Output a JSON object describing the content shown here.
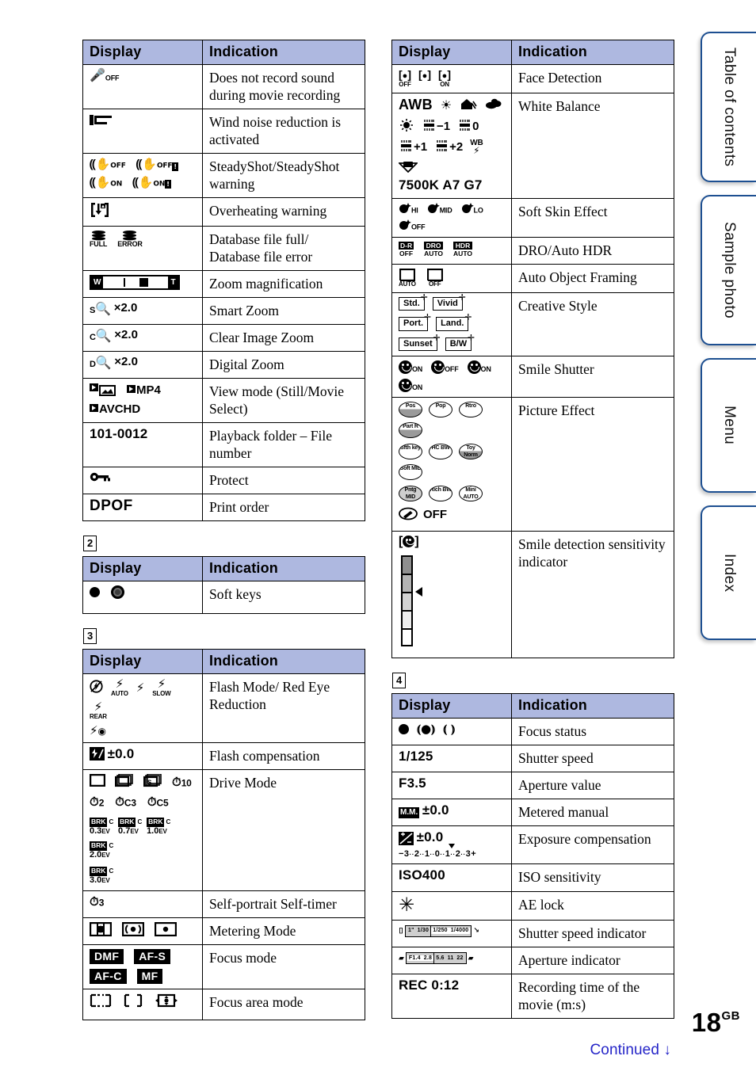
{
  "page": {
    "number": "18",
    "number_suffix": "GB",
    "continued_label": "Continued",
    "continued_arrow": "↓",
    "header_display": "Display",
    "header_indication": "Indication"
  },
  "sidebar": {
    "tabs": [
      {
        "label": "Table of contents",
        "name": "tab-table-of-contents"
      },
      {
        "label": "Sample photo",
        "name": "tab-sample-photo"
      },
      {
        "label": "Menu",
        "name": "tab-menu"
      },
      {
        "label": "Index",
        "name": "tab-index"
      }
    ]
  },
  "sections": [
    {
      "id": "1",
      "number_label": "",
      "column": "left",
      "rows": [
        {
          "indication": "Does not record sound during movie recording",
          "icons": [
            "mic-off-icon"
          ]
        },
        {
          "indication": "Wind noise reduction is activated",
          "icons": [
            "wind-noise-icon"
          ]
        },
        {
          "indication": "SteadyShot/SteadyShot warning",
          "icons": [
            "steadyshot-off",
            "steadyshot-off-warning",
            "steadyshot-on",
            "steadyshot-on-warning"
          ]
        },
        {
          "indication": "Overheating warning",
          "icons": [
            "overheating-icon"
          ]
        },
        {
          "indication": "Database file full/ Database file error",
          "icons": [
            "database-full-icon",
            "database-error-icon"
          ]
        },
        {
          "indication": "Zoom magnification",
          "icons": [
            "zoom-bar-icon"
          ]
        },
        {
          "indication": "Smart Zoom",
          "icons": [
            "smart-zoom-icon"
          ],
          "value": "×2.0",
          "prefix": "S"
        },
        {
          "indication": "Clear Image Zoom",
          "icons": [
            "clear-image-zoom-icon"
          ],
          "value": "×2.0",
          "prefix": "C"
        },
        {
          "indication": "Digital Zoom",
          "icons": [
            "digital-zoom-icon"
          ],
          "value": "×2.0",
          "prefix": "D"
        },
        {
          "indication": "View mode (Still/Movie Select)",
          "icons": [
            "view-still-icon",
            "view-mp4-icon",
            "view-avchd-icon"
          ],
          "labels": [
            "MP4",
            "AVCHD"
          ]
        },
        {
          "indication": "Playback folder – File number",
          "value": "101-0012"
        },
        {
          "indication": "Protect",
          "icons": [
            "protect-key-icon"
          ]
        },
        {
          "indication": "Print order",
          "value": "DPOF"
        }
      ]
    },
    {
      "id": "2",
      "number_label": "2",
      "column": "left",
      "rows": [
        {
          "indication": "Soft keys",
          "icons": [
            "soft-key-dot-icon",
            "soft-key-dial-icon"
          ]
        }
      ]
    },
    {
      "id": "3",
      "number_label": "3",
      "column": "left",
      "rows": [
        {
          "indication": "Flash Mode/ Red Eye Reduction",
          "icons": [
            "flash-off-icon",
            "flash-auto-icon",
            "flash-on-icon",
            "flash-slow-icon",
            "flash-rear-icon",
            "red-eye-icon"
          ],
          "labels": [
            "AUTO",
            "SLOW",
            "REAR"
          ]
        },
        {
          "indication": "Flash compensation",
          "value": "±0.0",
          "icons": [
            "flash-compensation-icon"
          ]
        },
        {
          "indication": "Drive Mode",
          "icons": [
            "single-shoot-icon",
            "continuous-icon",
            "speed-priority-icon",
            "self-timer-10-icon",
            "self-timer-2-icon",
            "self-timer-c3-icon",
            "self-timer-c5-icon",
            "bracket-icon"
          ],
          "labels": [
            "10",
            "2",
            "C3",
            "C5",
            "0.3EV",
            "0.7EV",
            "1.0EV",
            "2.0EV",
            "3.0EV",
            "BRK",
            "C"
          ]
        },
        {
          "indication": "Self-portrait Self-timer",
          "icons": [
            "self-portrait-timer-icon"
          ],
          "labels": [
            "3"
          ]
        },
        {
          "indication": "Metering Mode",
          "icons": [
            "multi-metering-icon",
            "center-metering-icon",
            "spot-metering-icon"
          ]
        },
        {
          "indication": "Focus mode",
          "labels": [
            "DMF",
            "AF-S",
            "AF-C",
            "MF"
          ]
        },
        {
          "indication": "Focus area mode",
          "icons": [
            "focus-area-multi-icon",
            "focus-area-center-icon",
            "focus-area-flexible-icon"
          ]
        }
      ]
    },
    {
      "id": "right-1",
      "number_label": "",
      "column": "right",
      "rows": [
        {
          "indication": "Face Detection",
          "icons": [
            "face-detection-off-icon",
            "face-detection-child-icon",
            "face-detection-on-icon"
          ],
          "labels": [
            "OFF",
            "ON"
          ]
        },
        {
          "indication": "White Balance",
          "labels": [
            "AWB",
            "7500K A7 G7",
            "-1",
            "0",
            "+1",
            "+2",
            "WB"
          ],
          "icons": [
            "wb-daylight-icon",
            "wb-shade-icon",
            "wb-cloudy-icon",
            "wb-incandescent-icon",
            "wb-fluorescent-icon",
            "wb-flash-icon",
            "wb-custom-icon"
          ]
        },
        {
          "indication": "Soft Skin Effect",
          "labels": [
            "HI",
            "MID",
            "LO",
            "OFF"
          ],
          "icons": [
            "soft-skin-icon"
          ]
        },
        {
          "indication": "DRO/Auto HDR",
          "labels": [
            "D-R OFF",
            "DRO AUTO",
            "HDR AUTO"
          ]
        },
        {
          "indication": "Auto Object Framing",
          "labels": [
            "AUTO",
            "OFF"
          ],
          "icons": [
            "auto-object-framing-icon"
          ]
        },
        {
          "indication": "Creative Style",
          "labels": [
            "Std.",
            "Vivid",
            "Port.",
            "Land.",
            "Sunset",
            "B/W"
          ]
        },
        {
          "indication": "Smile Shutter",
          "labels": [
            "ON",
            "OFF",
            "ON",
            "ON"
          ],
          "icons": [
            "smile-shutter-icon"
          ]
        },
        {
          "indication": "Picture Effect",
          "labels": [
            "Pos",
            "Pop",
            "Rtro",
            "Part R",
            "Sfth key",
            "HC BW",
            "Toy Norm",
            "Soft MID",
            "Pntg MID",
            "Rich BW",
            "Mini AUTO",
            "OFF"
          ]
        },
        {
          "indication": "Smile detection sensitivity indicator",
          "icons": [
            "smile-sensitivity-bar-icon"
          ]
        }
      ]
    },
    {
      "id": "4",
      "number_label": "4",
      "column": "right",
      "rows": [
        {
          "indication": "Focus status",
          "icons": [
            "focus-locked-icon",
            "focus-tracking-icon",
            "focus-searching-icon"
          ]
        },
        {
          "indication": "Shutter speed",
          "value": "1/125"
        },
        {
          "indication": "Aperture value",
          "value": "F3.5"
        },
        {
          "indication": "Metered manual",
          "value": "±0.0",
          "labels": [
            "M.M."
          ]
        },
        {
          "indication": "Exposure compensation",
          "value": "±0.0",
          "labels": [
            "-3",
            "2",
            "1",
            "0",
            "1",
            "2",
            "3+"
          ]
        },
        {
          "indication": "ISO sensitivity",
          "value": "ISO400"
        },
        {
          "indication": "AE lock",
          "icons": [
            "ae-lock-asterisk-icon"
          ]
        },
        {
          "indication": "Shutter speed indicator",
          "labels": [
            "1\"",
            "1/30",
            "1/250",
            "1/4000"
          ]
        },
        {
          "indication": "Aperture indicator",
          "labels": [
            "F1.4",
            "2.8",
            "5.6",
            "11",
            "22"
          ]
        },
        {
          "indication": "Recording time of the movie (m:s)",
          "value": "REC 0:12"
        }
      ]
    }
  ]
}
